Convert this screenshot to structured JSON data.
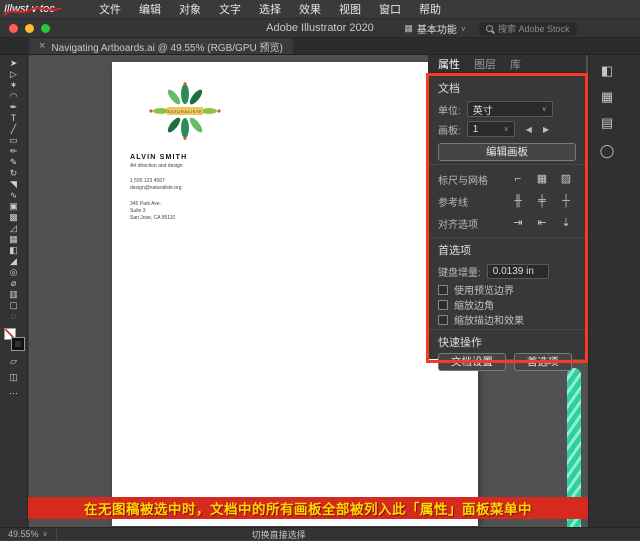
{
  "watermark": {
    "text": "Illwst v toc"
  },
  "menubar": {
    "items": [
      "文件",
      "编辑",
      "对象",
      "文字",
      "选择",
      "效果",
      "视图",
      "窗口",
      "帮助"
    ]
  },
  "titlebar": {
    "title": "Adobe Illustrator 2020",
    "workspace": "基本功能",
    "search_placeholder": "搜索 Adobe Stock"
  },
  "tabbar": {
    "close": "×",
    "doc_tab": "Navigating Artboards.ai @ 49.55% (RGB/GPU 预览)"
  },
  "toolbar": {
    "tools": [
      {
        "name": "selection-tool",
        "glyph": "➤"
      },
      {
        "name": "direct-selection-tool",
        "glyph": "▷"
      },
      {
        "name": "magic-wand-tool",
        "glyph": "✶"
      },
      {
        "name": "lasso-tool",
        "glyph": "◠"
      },
      {
        "name": "pen-tool",
        "glyph": "✒"
      },
      {
        "name": "type-tool",
        "glyph": "T"
      },
      {
        "name": "line-segment-tool",
        "glyph": "╱"
      },
      {
        "name": "rectangle-tool",
        "glyph": "▭"
      },
      {
        "name": "paintbrush-tool",
        "glyph": "✏"
      },
      {
        "name": "pencil-tool",
        "glyph": "✎"
      },
      {
        "name": "rotate-tool",
        "glyph": "↻"
      },
      {
        "name": "scale-tool",
        "glyph": "◥"
      },
      {
        "name": "width-tool",
        "glyph": "∿"
      },
      {
        "name": "free-transform-tool",
        "glyph": "▣"
      },
      {
        "name": "shape-builder-tool",
        "glyph": "▩"
      },
      {
        "name": "perspective-grid-tool",
        "glyph": "◿"
      },
      {
        "name": "mesh-tool",
        "glyph": "▦"
      },
      {
        "name": "gradient-tool",
        "glyph": "◧"
      },
      {
        "name": "eyedropper-tool",
        "glyph": "◢"
      },
      {
        "name": "blend-tool",
        "glyph": "◎"
      },
      {
        "name": "symbol-sprayer-tool",
        "glyph": "⌀"
      },
      {
        "name": "graph-tool",
        "glyph": "▥"
      },
      {
        "name": "artboard-tool",
        "glyph": "▢"
      },
      {
        "name": "zoom-tool",
        "glyph": "◌"
      }
    ],
    "extras": [
      {
        "name": "draw-mode-icon",
        "glyph": "▱"
      },
      {
        "name": "screen-mode-icon",
        "glyph": "◫"
      },
      {
        "name": "more-icon",
        "glyph": "⋯"
      }
    ]
  },
  "artboard": {
    "brand": "NATURALISTE",
    "name": "ALVIN SMITH",
    "role": "Art direction and design",
    "phone": "1 555 123 4567",
    "email": "design@naturaliste.org",
    "address": [
      "345 Park Ave.",
      "Suite 3",
      "San Jose, CA 95110"
    ]
  },
  "panel": {
    "tabs": [
      "属性",
      "图层",
      "库"
    ],
    "document": {
      "title": "文档",
      "units_label": "单位:",
      "units_value": "英寸",
      "artboard_label": "画板:",
      "artboard_value": "1",
      "prev_glyph": "◀",
      "next_glyph": "▶",
      "edit_button": "编辑画板"
    },
    "icon_rows": [
      {
        "label": "标尺与网格",
        "icons": [
          {
            "name": "ruler-icon",
            "glyph": "⌐"
          },
          {
            "name": "grid-icon",
            "glyph": "▦"
          },
          {
            "name": "transparency-grid-icon",
            "glyph": "▨"
          }
        ]
      },
      {
        "label": "参考线",
        "icons": [
          {
            "name": "guides-icon",
            "glyph": "╫"
          },
          {
            "name": "lock-guides-icon",
            "glyph": "╪"
          },
          {
            "name": "smart-guides-icon",
            "glyph": "┼"
          }
        ]
      },
      {
        "label": "对齐选项",
        "icons": [
          {
            "name": "snap-to-pixel-icon",
            "glyph": "⇥"
          },
          {
            "name": "snap-to-point-icon",
            "glyph": "⇤"
          },
          {
            "name": "snap-to-glyph-icon",
            "glyph": "⇣"
          }
        ]
      }
    ],
    "preferences": {
      "title": "首选项",
      "keyboard_label": "键盘增量:",
      "keyboard_value": "0.0139 in",
      "checkboxes": [
        "使用预览边界",
        "缩放边角",
        "缩放描边和效果"
      ]
    },
    "quick_actions": {
      "title": "快速操作",
      "buttons": [
        "文档设置",
        "首选项"
      ]
    }
  },
  "right_strip": {
    "hamburger": "≡",
    "icons": [
      {
        "name": "color-panel-icon",
        "glyph": "◧"
      },
      {
        "name": "swatches-panel-icon",
        "glyph": "▦"
      },
      {
        "name": "libraries-panel-icon",
        "glyph": "▤"
      },
      {
        "name": "sync-icon",
        "glyph": "◯"
      }
    ]
  },
  "caption": {
    "text": "在无图稿被选中时，文档中的所有画板全部被列入此「属性」面板菜单中"
  },
  "statusbar": {
    "zoom": "49.55%",
    "hint": "切换直接选择"
  },
  "ui": {
    "caret": "∨"
  }
}
